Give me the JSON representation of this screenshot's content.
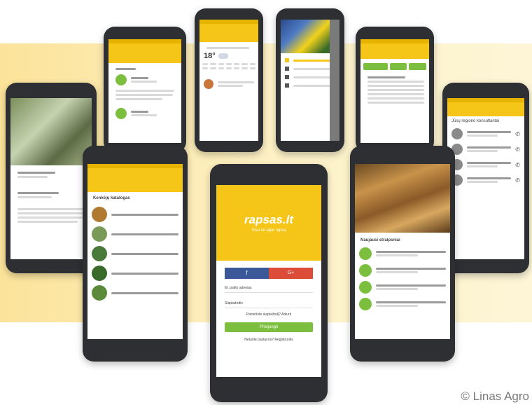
{
  "login": {
    "logo": "rapsas.lt",
    "tagline": "Visa tai apie rapsą",
    "facebook_label": "f",
    "google_label": "G+",
    "email_label": "El. pašto adresas",
    "password_label": "Slaptažodis",
    "forgot_label": "Pamiršote slaptažodį? Atkurti",
    "login_button": "Prisijungti",
    "register_label": "Neturite paskyros? Registruotis"
  },
  "weather": {
    "temperature": "18°"
  },
  "contacts_title": "Jūsų regiono konsultantai",
  "articles_title": "Naujausi straipsniai",
  "categories_title": "Kenkėjų katalogas",
  "wheat_list_title": "Naujausi straipsniai",
  "credit": "© Linas Agro",
  "colors": {
    "accent": "#f5c518",
    "green": "#7cbf3f",
    "facebook": "#3b5998",
    "google": "#dd4b39"
  }
}
